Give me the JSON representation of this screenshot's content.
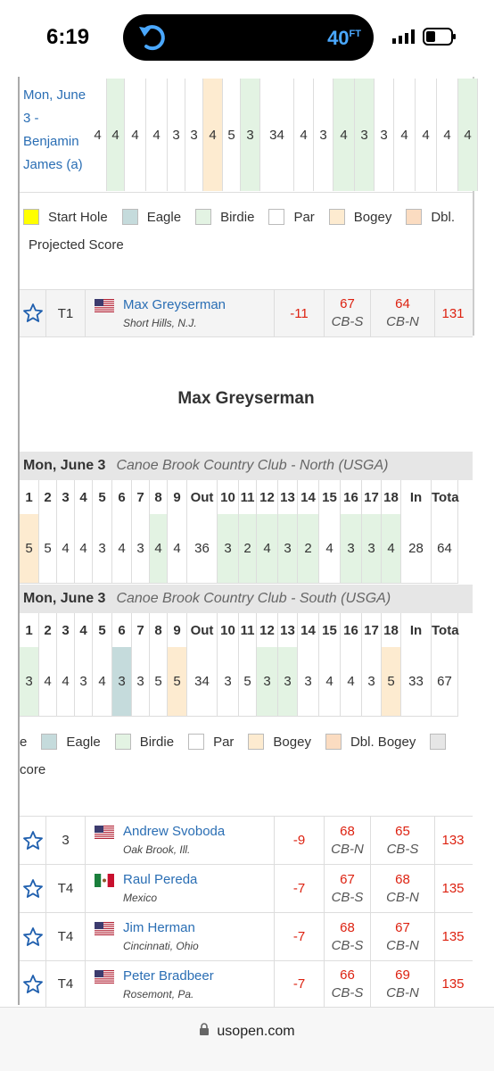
{
  "status_bar": {
    "time": "6:19",
    "temperature": "40",
    "temp_unit": "FT"
  },
  "top_card": {
    "player_date": "Mon, June 3 - Benjamin James (a)",
    "cells": [
      {
        "v": "4",
        "t": "par"
      },
      {
        "v": "4",
        "t": "birdie"
      },
      {
        "v": "4",
        "t": "par"
      },
      {
        "v": "4",
        "t": "par"
      },
      {
        "v": "3",
        "t": "par"
      },
      {
        "v": "3",
        "t": "par"
      },
      {
        "v": "4",
        "t": "bogey"
      },
      {
        "v": "5",
        "t": "par"
      },
      {
        "v": "3",
        "t": "birdie"
      },
      {
        "v": "34",
        "t": "par"
      },
      {
        "v": "4",
        "t": "par"
      },
      {
        "v": "3",
        "t": "par"
      },
      {
        "v": "4",
        "t": "birdie"
      },
      {
        "v": "3",
        "t": "birdie"
      },
      {
        "v": "3",
        "t": "par"
      },
      {
        "v": "4",
        "t": "par"
      },
      {
        "v": "4",
        "t": "par"
      },
      {
        "v": "4",
        "t": "par"
      },
      {
        "v": "4",
        "t": "birdie"
      }
    ]
  },
  "legend_top": {
    "items": [
      {
        "label": "Start Hole",
        "color": "#ffff00"
      },
      {
        "label": "Eagle",
        "color": "#c5dbdc"
      },
      {
        "label": "Birdie",
        "color": "#e3f3e3"
      },
      {
        "label": "Par",
        "color": "#ffffff"
      },
      {
        "label": "Bogey",
        "color": "#fdebd0"
      },
      {
        "label": "Dbl.",
        "color": "#fbdcc1"
      }
    ],
    "projected": "Projected Score"
  },
  "leaders": [
    {
      "pos": "T1",
      "name": "Max Greyserman",
      "home": "Short Hills, N.J.",
      "to_par": "-11",
      "r1": "67",
      "c1": "CB-S",
      "r2": "64",
      "c2": "CB-N",
      "total": "131",
      "flag": "us"
    },
    {
      "pos": "3",
      "name": "Andrew Svoboda",
      "home": "Oak Brook, Ill.",
      "to_par": "-9",
      "r1": "68",
      "c1": "CB-N",
      "r2": "65",
      "c2": "CB-S",
      "total": "133",
      "flag": "us"
    },
    {
      "pos": "T4",
      "name": "Raul Pereda",
      "home": "Mexico",
      "to_par": "-7",
      "r1": "67",
      "c1": "CB-S",
      "r2": "68",
      "c2": "CB-N",
      "total": "135",
      "flag": "mx"
    },
    {
      "pos": "T4",
      "name": "Jim Herman",
      "home": "Cincinnati, Ohio",
      "to_par": "-7",
      "r1": "68",
      "c1": "CB-S",
      "r2": "67",
      "c2": "CB-N",
      "total": "135",
      "flag": "us"
    },
    {
      "pos": "T4",
      "name": "Peter Bradbeer",
      "home": "Rosemont, Pa.",
      "to_par": "-7",
      "r1": "66",
      "c1": "CB-S",
      "r2": "69",
      "c2": "CB-N",
      "total": "135",
      "flag": "us"
    }
  ],
  "expanded": {
    "title": "Max Greyserman",
    "rounds": [
      {
        "date": "Mon, June 3",
        "course": "Canoe Brook Country Club - North (USGA)",
        "holes": [
          "1",
          "2",
          "3",
          "4",
          "5",
          "6",
          "7",
          "8",
          "9",
          "Out",
          "10",
          "11",
          "12",
          "13",
          "14",
          "15",
          "16",
          "17",
          "18",
          "In",
          "Tota"
        ],
        "scores": [
          {
            "v": "5",
            "t": "bogey"
          },
          {
            "v": "5",
            "t": "par"
          },
          {
            "v": "4",
            "t": "par"
          },
          {
            "v": "4",
            "t": "par"
          },
          {
            "v": "3",
            "t": "par"
          },
          {
            "v": "4",
            "t": "par"
          },
          {
            "v": "3",
            "t": "par"
          },
          {
            "v": "4",
            "t": "birdie"
          },
          {
            "v": "4",
            "t": "par"
          },
          {
            "v": "36",
            "t": "par"
          },
          {
            "v": "3",
            "t": "birdie"
          },
          {
            "v": "2",
            "t": "birdie"
          },
          {
            "v": "4",
            "t": "birdie"
          },
          {
            "v": "3",
            "t": "birdie"
          },
          {
            "v": "2",
            "t": "birdie"
          },
          {
            "v": "4",
            "t": "par"
          },
          {
            "v": "3",
            "t": "birdie"
          },
          {
            "v": "3",
            "t": "birdie"
          },
          {
            "v": "4",
            "t": "birdie"
          },
          {
            "v": "28",
            "t": "par"
          },
          {
            "v": "64",
            "t": "par"
          }
        ]
      },
      {
        "date": "Mon, June 3",
        "course": "Canoe Brook Country Club - South (USGA)",
        "holes": [
          "1",
          "2",
          "3",
          "4",
          "5",
          "6",
          "7",
          "8",
          "9",
          "Out",
          "10",
          "11",
          "12",
          "13",
          "14",
          "15",
          "16",
          "17",
          "18",
          "In",
          "Tota"
        ],
        "scores": [
          {
            "v": "3",
            "t": "birdie"
          },
          {
            "v": "4",
            "t": "par"
          },
          {
            "v": "4",
            "t": "par"
          },
          {
            "v": "3",
            "t": "par"
          },
          {
            "v": "4",
            "t": "par"
          },
          {
            "v": "3",
            "t": "eagle"
          },
          {
            "v": "3",
            "t": "par"
          },
          {
            "v": "5",
            "t": "par"
          },
          {
            "v": "5",
            "t": "bogey"
          },
          {
            "v": "34",
            "t": "par"
          },
          {
            "v": "3",
            "t": "par"
          },
          {
            "v": "5",
            "t": "par"
          },
          {
            "v": "3",
            "t": "birdie"
          },
          {
            "v": "3",
            "t": "birdie"
          },
          {
            "v": "3",
            "t": "par"
          },
          {
            "v": "4",
            "t": "par"
          },
          {
            "v": "4",
            "t": "par"
          },
          {
            "v": "3",
            "t": "par"
          },
          {
            "v": "5",
            "t": "bogey"
          },
          {
            "v": "33",
            "t": "par"
          },
          {
            "v": "67",
            "t": "par"
          }
        ]
      }
    ],
    "legend": [
      {
        "label": "e",
        "color": null
      },
      {
        "label": "Eagle",
        "color": "#c5dbdc"
      },
      {
        "label": "Birdie",
        "color": "#e3f3e3"
      },
      {
        "label": "Par",
        "color": "#ffffff"
      },
      {
        "label": "Bogey",
        "color": "#fdebd0"
      },
      {
        "label": "Dbl. Bogey",
        "color": "#fbdcc1"
      }
    ],
    "projected": "core"
  },
  "browser": {
    "url": "usopen.com"
  },
  "colors": {
    "link": "#2a6eb4",
    "score_red": "#d21",
    "star_blue": "#1f5fae"
  }
}
